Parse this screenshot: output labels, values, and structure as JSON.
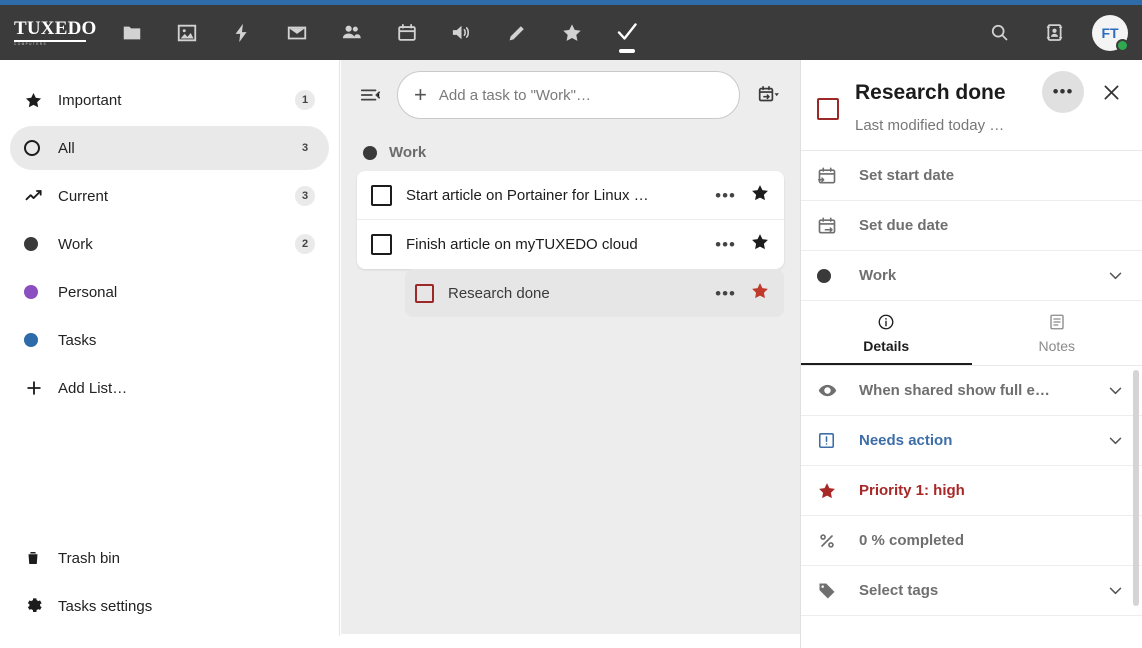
{
  "header": {
    "logo_text": "TUXEDO",
    "logo_sub": "COMPUTERS",
    "nav": [
      {
        "name": "files",
        "icon": "folder-icon",
        "active": false
      },
      {
        "name": "photos",
        "icon": "photos-icon",
        "active": false
      },
      {
        "name": "activity",
        "icon": "lightning-icon",
        "active": false
      },
      {
        "name": "mail",
        "icon": "mail-icon",
        "active": false
      },
      {
        "name": "contacts",
        "icon": "contacts-icon",
        "active": false
      },
      {
        "name": "calendar",
        "icon": "calendar-icon",
        "active": false
      },
      {
        "name": "announcements",
        "icon": "speaker-icon",
        "active": false
      },
      {
        "name": "notes",
        "icon": "pencil-icon",
        "active": false
      },
      {
        "name": "favorites",
        "icon": "star-icon",
        "active": false
      },
      {
        "name": "tasks",
        "icon": "check-icon",
        "active": true
      }
    ],
    "search_icon": "search-icon",
    "contacts_menu_icon": "contacts-card-icon",
    "avatar_initials": "FT",
    "avatar_status": "online"
  },
  "sidebar": {
    "items": [
      {
        "label": "Important",
        "count": "1",
        "icon": "star-icon",
        "selected": false
      },
      {
        "label": "All",
        "count": "3",
        "icon": "circle-outline-icon",
        "selected": true
      },
      {
        "label": "Current",
        "count": "3",
        "icon": "trending-up-icon",
        "selected": false
      },
      {
        "label": "Work",
        "count": "2",
        "icon": "dot-icon",
        "color": "#3a3a3a",
        "selected": false
      },
      {
        "label": "Personal",
        "count": "",
        "icon": "dot-icon",
        "color": "#8b4fc0",
        "selected": false
      },
      {
        "label": "Tasks",
        "count": "",
        "icon": "dot-icon",
        "color": "#2d6ca8",
        "selected": false
      },
      {
        "label": "Add List…",
        "count": "",
        "icon": "plus-icon",
        "selected": false
      }
    ],
    "bottom": [
      {
        "label": "Trash bin",
        "icon": "trash-icon"
      },
      {
        "label": "Tasks settings",
        "icon": "gear-icon"
      }
    ]
  },
  "main": {
    "collapse_icon": "collapse-list-icon",
    "add_placeholder": "Add a task to \"Work\"…",
    "add_value": "",
    "add_plus_icon": "plus-icon",
    "date_picker_icon": "calendar-due-icon",
    "group": {
      "title": "Work",
      "color": "#3a3a3a"
    },
    "tasks": [
      {
        "title": "Start article on Portainer for Linux …",
        "checked": false,
        "starred": true,
        "star_color": "#1c1c1c",
        "menu_icon": "more-icon",
        "subtask": false
      },
      {
        "title": "Finish article on myTUXEDO cloud",
        "checked": false,
        "starred": true,
        "star_color": "#1c1c1c",
        "menu_icon": "more-icon",
        "subtask": false
      }
    ],
    "subtasks": [
      {
        "title": "Research done",
        "checked": false,
        "starred": true,
        "star_color": "#c0392b",
        "menu_icon": "more-icon",
        "selected": true
      }
    ]
  },
  "detail": {
    "title": "Research done",
    "subtitle": "Last modified today …",
    "more_icon": "more-icon",
    "close_icon": "close-icon",
    "checkbox_color": "#9c2828",
    "rows_top": [
      {
        "label": "Set start date",
        "icon": "calendar-start-icon",
        "chevron": false
      },
      {
        "label": "Set due date",
        "icon": "calendar-due-icon",
        "chevron": false
      },
      {
        "label": "Work",
        "icon": "dot-icon",
        "color": "#3a3a3a",
        "chevron": true
      }
    ],
    "tabs": [
      {
        "label": "Details",
        "icon": "info-icon",
        "active": true
      },
      {
        "label": "Notes",
        "icon": "notes-icon",
        "active": false
      }
    ],
    "rows_details": [
      {
        "label": "When shared show full e…",
        "icon": "eye-icon",
        "chevron": true,
        "style": "normal"
      },
      {
        "label": "Needs action",
        "icon": "alert-box-icon",
        "chevron": true,
        "style": "blue"
      },
      {
        "label": "Priority 1: high",
        "icon": "star-icon",
        "chevron": false,
        "style": "red"
      },
      {
        "label": "0 % completed",
        "icon": "percent-icon",
        "chevron": false,
        "style": "normal"
      },
      {
        "label": "Select tags",
        "icon": "tag-icon",
        "chevron": true,
        "style": "normal"
      }
    ]
  },
  "colors": {
    "top_strip": "#2d6ca8",
    "header_bg": "#3b3b3b",
    "content_bg": "#ededed",
    "accent_blue": "#3d6ea8",
    "accent_red": "#a82828",
    "online_green": "#2fa84f"
  }
}
